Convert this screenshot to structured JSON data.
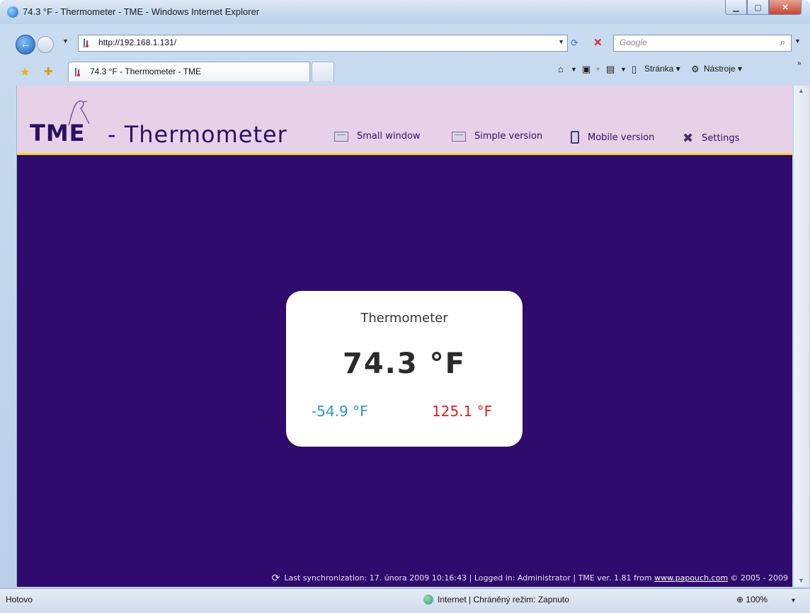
{
  "window": {
    "title": "74.3 °F - Thermometer - TME - Windows Internet Explorer"
  },
  "addressbar": {
    "url": "http://192.168.1.131/",
    "search_placeholder": "Google"
  },
  "tab": {
    "label": "74.3 °F - Thermometer - TME"
  },
  "commandbar": {
    "page_label": "Stránka",
    "tools_label": "Nástroje"
  },
  "header": {
    "logo": "TME",
    "title": "- Thermometer",
    "menu": [
      {
        "label": "Small window",
        "icon": "window-icon"
      },
      {
        "label": "Simple version",
        "icon": "window-icon"
      },
      {
        "label": "Mobile version",
        "icon": "mobile-icon"
      },
      {
        "label": "Settings",
        "icon": "settings-icon"
      }
    ]
  },
  "card": {
    "title": "Thermometer",
    "temperature": "74.3 °F",
    "min": "-54.9 °F",
    "max": "125.1 °F",
    "min_color": "#2f93e0",
    "max_color": "#e11d1d"
  },
  "footer": {
    "text": "Last synchronization: 17. února 2009 10:16:43 | Logged in: Administrator | TME ver. 1.81 from",
    "link": "www.papouch.com",
    "copyright": "© 2005 - 2009"
  },
  "statusbar": {
    "left": "Hotovo",
    "zone": "Internet | Chráněný režim: Zapnuto",
    "zoom": "100%"
  },
  "colors": {
    "page_background": "#2e0b6c",
    "header_background": "#e7d1e9",
    "header_border": "#f1d72a",
    "brand": "#2b1163"
  }
}
